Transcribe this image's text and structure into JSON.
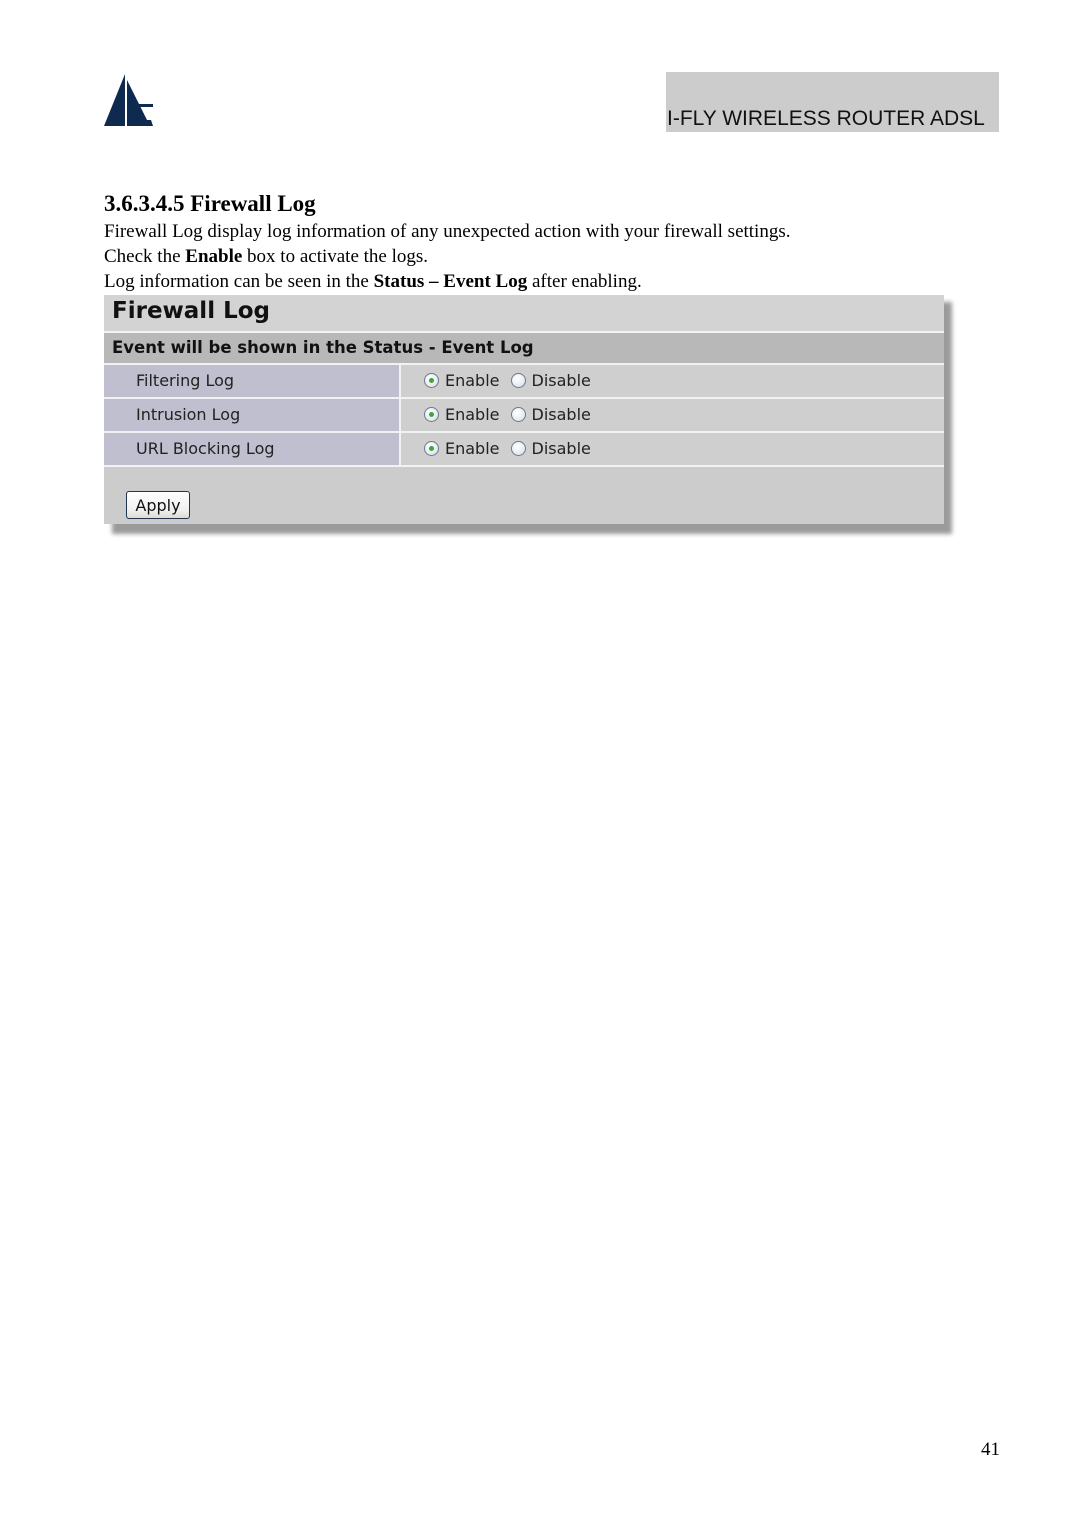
{
  "header": {
    "logo_icon": "atlantis-sail-logo",
    "product_name": "I-FLY WIRELESS ROUTER ADSL"
  },
  "section": {
    "title": "3.6.3.4.5 Firewall Log",
    "paragraph1": "Firewall Log display log information of any unexpected action with your firewall settings.",
    "paragraph2": {
      "before": "Check the ",
      "bold": "Enable",
      "after": " box to activate the logs."
    },
    "paragraph3": {
      "before": "Log information can be seen in the ",
      "bold": "Status – Event Log",
      "after": " after enabling."
    }
  },
  "panel": {
    "title": "Firewall Log",
    "subtitle": "Event will be shown in the Status - Event Log",
    "rows": [
      {
        "label": "Filtering Log",
        "options": [
          "Enable",
          "Disable"
        ],
        "selected": "Enable"
      },
      {
        "label": "Intrusion Log",
        "options": [
          "Enable",
          "Disable"
        ],
        "selected": "Enable"
      },
      {
        "label": "URL Blocking Log",
        "options": [
          "Enable",
          "Disable"
        ],
        "selected": "Enable"
      }
    ],
    "apply_label": "Apply"
  },
  "colors": {
    "logo": "#0f2a4f",
    "banner": "#cccccc",
    "radio_checked": "#3fa43f"
  },
  "footer": {
    "page_number": "41"
  }
}
